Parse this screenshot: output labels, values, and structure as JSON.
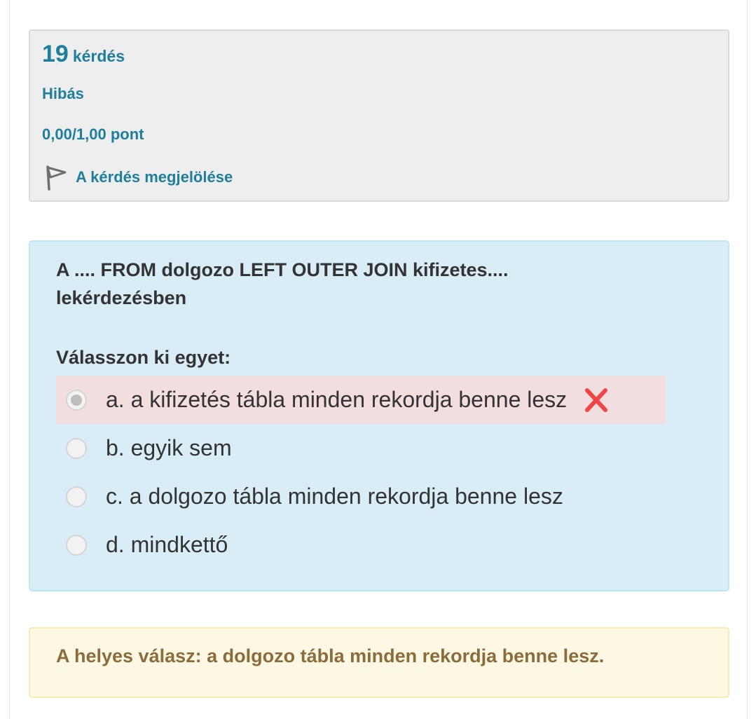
{
  "info": {
    "number": "19",
    "question_word": "kérdés",
    "state": "Hibás",
    "grade": "0,00/1,00 pont",
    "flag_label": "A kérdés megjelölése",
    "flag_icon": "flag-icon"
  },
  "question": {
    "text": "A .... FROM dolgozo LEFT OUTER JOIN kifizetes.... lekérdezésben",
    "prompt": "Válasszon ki egyet:",
    "answers": [
      {
        "label": "a. a kifizetés tábla minden rekordja benne lesz",
        "selected": true,
        "state": "incorrect"
      },
      {
        "label": "b. egyik sem",
        "selected": false
      },
      {
        "label": "c. a dolgozo tábla minden rekordja benne lesz",
        "selected": false
      },
      {
        "label": "d. mindkettő",
        "selected": false
      }
    ],
    "incorrect_icon": "cross-icon"
  },
  "feedback": {
    "right_answer": "A helyes válasz: a dolgozo tábla minden rekordja benne lesz."
  },
  "colors": {
    "accent": "#1f7e99",
    "question_bg": "#d9edf7",
    "incorrect_bg": "#f2dede",
    "incorrect_mark": "#f04545",
    "feedback_bg": "#fcf8e3",
    "feedback_text": "#8a6d3b"
  }
}
